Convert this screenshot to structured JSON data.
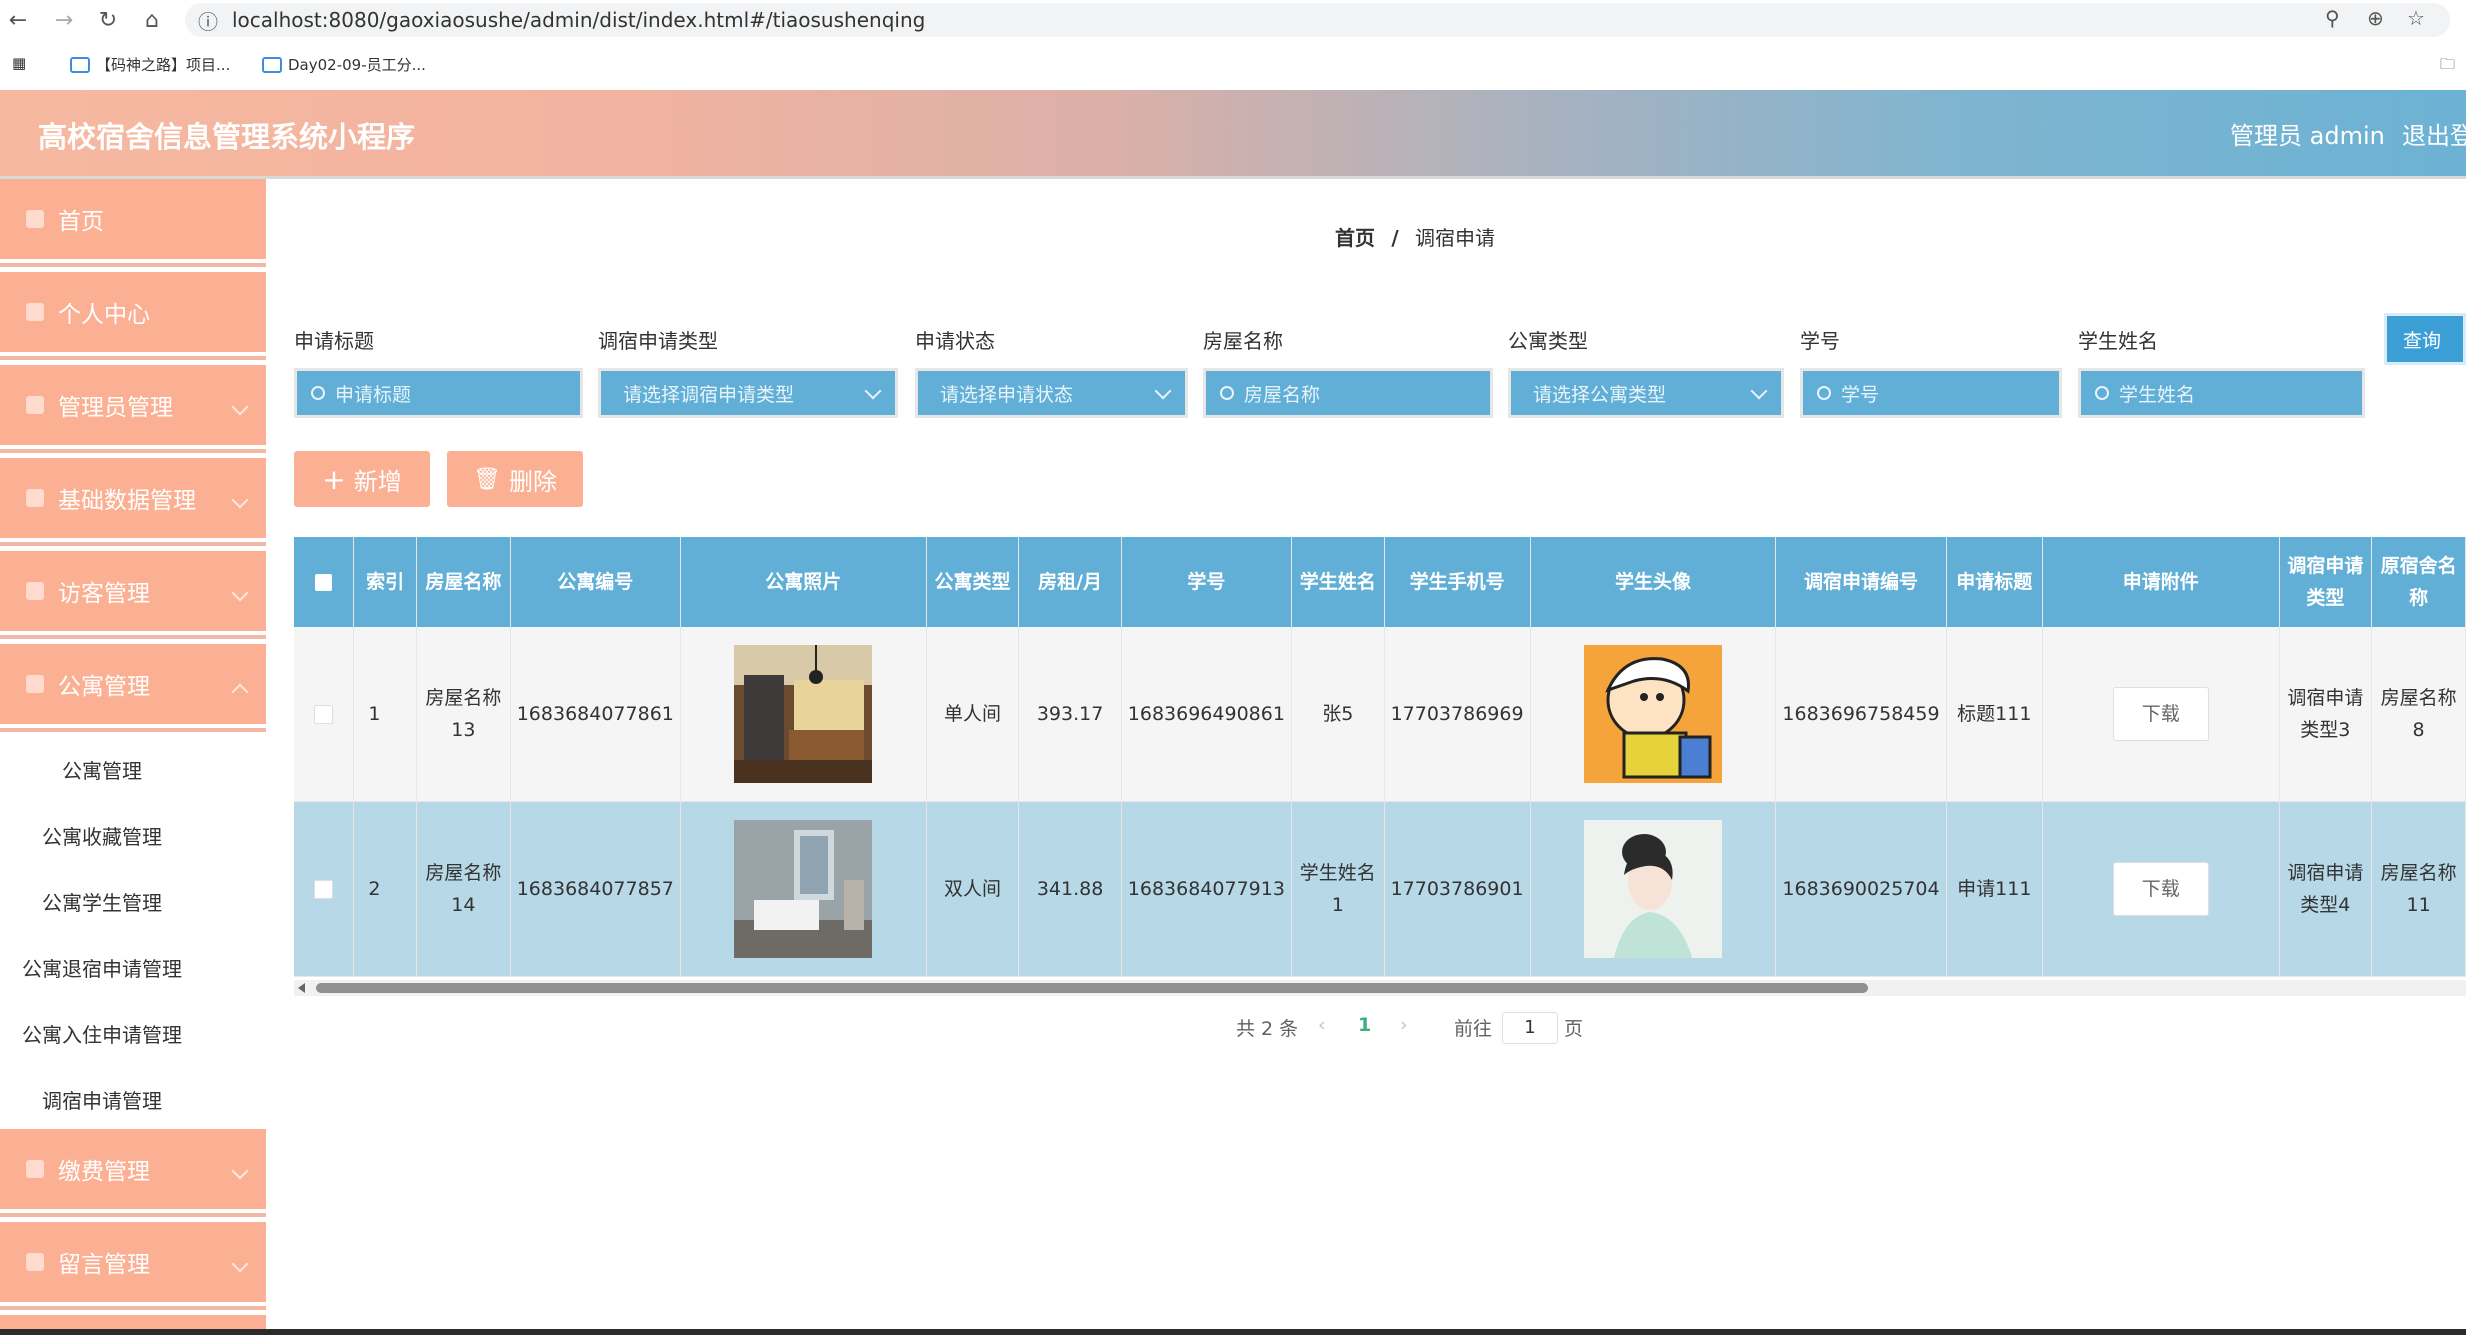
{
  "browser": {
    "url": "localhost:8080/gaoxiaosushe/admin/dist/index.html#/tiaosushenqing",
    "bookmarks": [
      "【码神之路】项目...",
      "Day02-09-员工分..."
    ]
  },
  "header": {
    "title": "高校宿舍信息管理系统小程序",
    "user": "管理员 admin",
    "logout": "退出登录"
  },
  "sidebar": {
    "items": [
      "首页",
      "个人中心",
      "管理员管理",
      "基础数据管理",
      "访客管理",
      "公寓管理"
    ],
    "subitems": [
      "公寓管理",
      "公寓收藏管理",
      "公寓学生管理",
      "公寓退宿申请管理",
      "公寓入住申请管理",
      "调宿申请管理"
    ],
    "items_after": [
      "缴费管理",
      "留言管理"
    ]
  },
  "breadcrumb": {
    "home": "首页",
    "separator": "/",
    "current": "调宿申请"
  },
  "filters": [
    {
      "label": "申请标题",
      "placeholder": "申请标题",
      "type": "input"
    },
    {
      "label": "调宿申请类型",
      "placeholder": "请选择调宿申请类型",
      "type": "select"
    },
    {
      "label": "申请状态",
      "placeholder": "请选择申请状态",
      "type": "select"
    },
    {
      "label": "房屋名称",
      "placeholder": "房屋名称",
      "type": "input"
    },
    {
      "label": "公寓类型",
      "placeholder": "请选择公寓类型",
      "type": "select"
    },
    {
      "label": "学号",
      "placeholder": "学号",
      "type": "input"
    },
    {
      "label": "学生姓名",
      "placeholder": "学生姓名",
      "type": "input"
    }
  ],
  "buttons": {
    "query": "查询",
    "add": "新增",
    "delete": "删除"
  },
  "table": {
    "headers": [
      "索引",
      "房屋名称",
      "公寓编号",
      "公寓照片",
      "公寓类型",
      "房租/月",
      "学号",
      "学生姓名",
      "学生手机号",
      "学生头像",
      "调宿申请编号",
      "申请标题",
      "申请附件",
      "调宿申请类型",
      "原宿舍名称"
    ],
    "rows": [
      {
        "index": "1",
        "house": "房屋名称13",
        "apt_no": "1683684077861",
        "apt_type": "单人间",
        "rent": "393.17",
        "student_no": "1683696490861",
        "name": "张5",
        "phone": "17703786969",
        "apply_no": "1683696758459",
        "title": "标题111",
        "attachment": "下载",
        "apply_type": "调宿申请类型3",
        "orig": "房屋名称8"
      },
      {
        "index": "2",
        "house": "房屋名称14",
        "apt_no": "1683684077857",
        "apt_type": "双人间",
        "rent": "341.88",
        "student_no": "1683684077913",
        "name": "学生姓名1",
        "phone": "17703786901",
        "apply_no": "1683690025704",
        "title": "申请111",
        "attachment": "下载",
        "apply_type": "调宿申请类型4",
        "orig": "房屋名称11"
      }
    ]
  },
  "pagination": {
    "total": "共 2 条",
    "current": "1",
    "goto_prefix": "前往",
    "goto_value": "1",
    "goto_suffix": "页"
  },
  "colors": {
    "accent_orange": "#fcb093",
    "accent_blue": "#61afd6",
    "row_highlight": "#b6d8e7"
  }
}
